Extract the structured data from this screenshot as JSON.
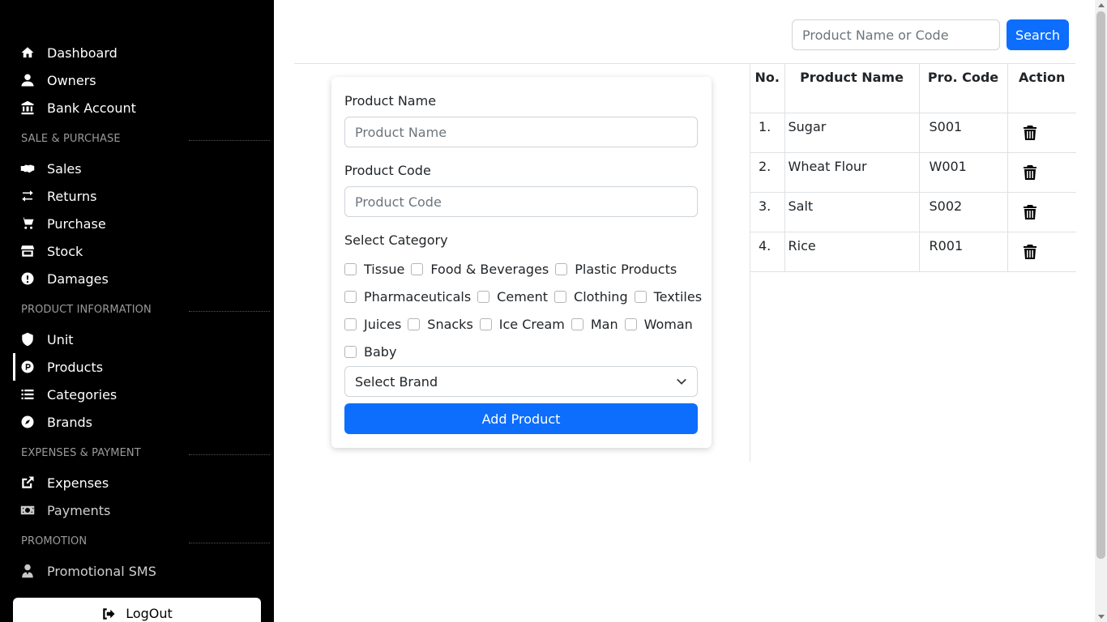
{
  "sidebar": {
    "items": {
      "dashboard": "Dashboard",
      "owners": "Owners",
      "bank_account": "Bank Account",
      "sales": "Sales",
      "returns": "Returns",
      "purchase": "Purchase",
      "stock": "Stock",
      "damages": "Damages",
      "unit": "Unit",
      "products": "Products",
      "categories": "Categories",
      "brands": "Brands",
      "expenses": "Expenses",
      "payments": "Payments",
      "promotional_sms": "Promotional SMS"
    },
    "sections": {
      "sale_purchase": "SALE & PURCHASE",
      "product_information": "PRODUCT INFORMATION",
      "expenses_payment": "EXPENSES & PAYMENT",
      "promotion": "PROMOTION"
    },
    "logout": "LogOut",
    "active_item": "Products"
  },
  "search": {
    "placeholder": "Product Name or Code",
    "button": "Search"
  },
  "form": {
    "product_name_label": "Product Name",
    "product_name_placeholder": "Product Name",
    "product_code_label": "Product Code",
    "product_code_placeholder": "Product Code",
    "category_label": "Select Category",
    "categories": [
      "Tissue",
      "Food & Beverages",
      "Plastic Products",
      "Pharmaceuticals",
      "Cement",
      "Clothing",
      "Textiles",
      "Juices",
      "Snacks",
      "Ice Cream",
      "Man",
      "Woman",
      "Baby"
    ],
    "brand_select": "Select Brand",
    "add_button": "Add Product"
  },
  "table": {
    "headers": [
      "No.",
      "Product Name",
      "Pro. Code",
      "Action"
    ],
    "rows": [
      {
        "no": "1.",
        "name": "Sugar",
        "code": "S001"
      },
      {
        "no": "2.",
        "name": "Wheat Flour",
        "code": "W001"
      },
      {
        "no": "3.",
        "name": "Salt",
        "code": "S002"
      },
      {
        "no": "4.",
        "name": "Rice",
        "code": "R001"
      }
    ]
  },
  "colors": {
    "sidebar_bg": "#000000",
    "primary": "#0d6efd"
  }
}
